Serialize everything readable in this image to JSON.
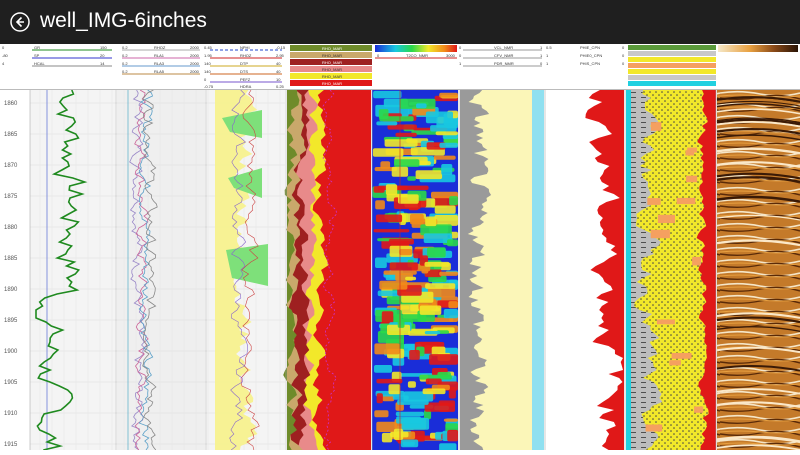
{
  "window": {
    "title": "well_IMG-6inches"
  },
  "icons": {
    "back": "back-arrow-icon"
  },
  "header": {
    "track1": [
      {
        "left": "0",
        "name": "GR",
        "right": "150",
        "color": "#1f8a1f"
      },
      {
        "left": "-80",
        "name": "SP",
        "right": "20",
        "color": "#3333cc"
      },
      {
        "left": "4",
        "name": "HCAL",
        "right": "14",
        "color": "#7a7a7a"
      }
    ],
    "track2": [
      {
        "left": "0.2",
        "name": "RHOZ",
        "right": "2000"
      },
      {
        "left": "0.2",
        "name": "RLA1",
        "right": "2000"
      },
      {
        "left": "0.2",
        "name": "RLA3",
        "right": "2000"
      },
      {
        "left": "0.2",
        "name": "RLA5",
        "right": "2000"
      }
    ],
    "track3": [
      {
        "left": "0.45",
        "name": "NPHI",
        "right": "-0.15"
      },
      {
        "left": "1.95",
        "name": "RHOZ",
        "right": "2.95"
      },
      {
        "left": "140",
        "name": "DTP",
        "right": "40"
      },
      {
        "left": "140",
        "name": "DTS",
        "right": "40"
      },
      {
        "left": "0",
        "name": "PEFZ",
        "right": "10"
      },
      {
        "left": "-0.75",
        "name": "HDRA",
        "right": "0.25"
      }
    ],
    "track4": [
      "RHO_MAR",
      "RHO_MAR",
      "RHO_MAR",
      "RHO_MAR",
      "RHO_MAR",
      "RHO_MAR"
    ],
    "track5": [
      {
        "left": "0",
        "name": "T2CO_NMR",
        "right": "3000"
      }
    ],
    "track6": [
      {
        "left": "0",
        "name": "VCL_NMR",
        "right": "1"
      },
      {
        "left": "0",
        "name": "CFV_NMR",
        "right": "1"
      },
      {
        "left": "1",
        "name": "PDR_NMR",
        "right": "0"
      }
    ],
    "track7": [
      {
        "left": "0.5",
        "name": "PHIE_CPN",
        "right": "0"
      },
      {
        "left": "1",
        "name": "PHIE0_CPN",
        "right": "0"
      },
      {
        "left": "1",
        "name": "PHIS_CPN",
        "right": "0"
      }
    ]
  },
  "depth_track": {
    "labels": [
      "1860",
      "1865",
      "1870",
      "1875",
      "1880",
      "1885",
      "1890",
      "1895",
      "1900",
      "1905",
      "1910",
      "1915"
    ]
  }
}
